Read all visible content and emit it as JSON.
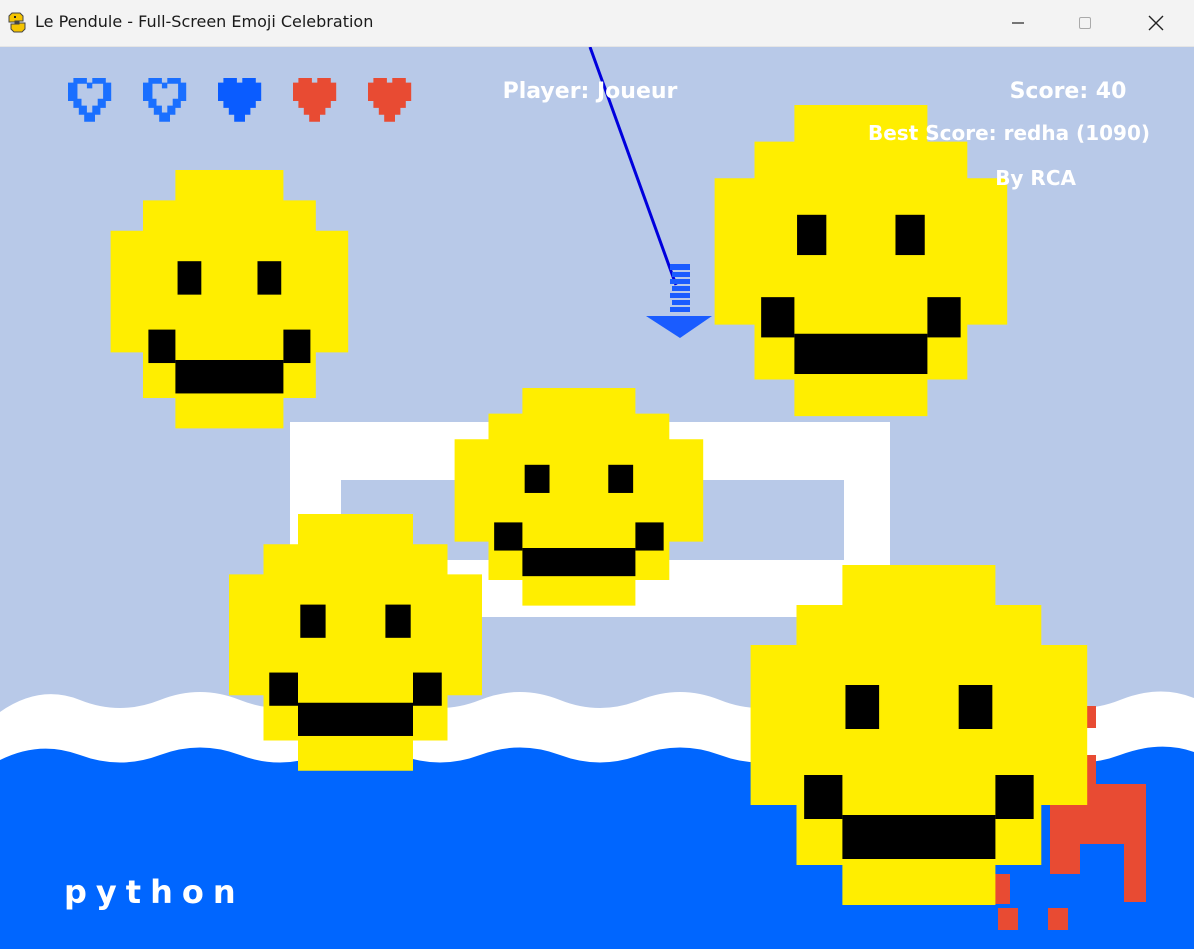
{
  "window": {
    "title": "Le Pendule - Full-Screen Emoji Celebration",
    "icon": "python-snake-icon",
    "controls": [
      "minimize-icon",
      "maximize-icon",
      "close-icon"
    ]
  },
  "hud": {
    "player_label": "Player: Joueur",
    "score_label": "Score: 40",
    "best_score_label": "Best Score: redha (1090)",
    "credit_label": "By RCA"
  },
  "lives": {
    "icon": "heart-icon",
    "total": 5,
    "states": [
      "outline",
      "outline",
      "filled",
      "filled",
      "filled"
    ],
    "colors": [
      "#1a6fff",
      "#1a6fff",
      "#0a5cff",
      "#e84b33",
      "#e84b33"
    ]
  },
  "footer_text": "python",
  "colors": {
    "sky": "#b8c9e8",
    "sea": "#0066ff",
    "foam": "#ffffff",
    "emoji": "#ffee00",
    "pendulum": "#0000dd",
    "arrow": "#1a5cff",
    "creature": "#e84b33"
  },
  "sprites": {
    "emoji": "smiley-face-icon",
    "pendulum": "pendulum-arrow",
    "goal_frame": "goal-frame",
    "creature": "pixel-creature-icon"
  }
}
